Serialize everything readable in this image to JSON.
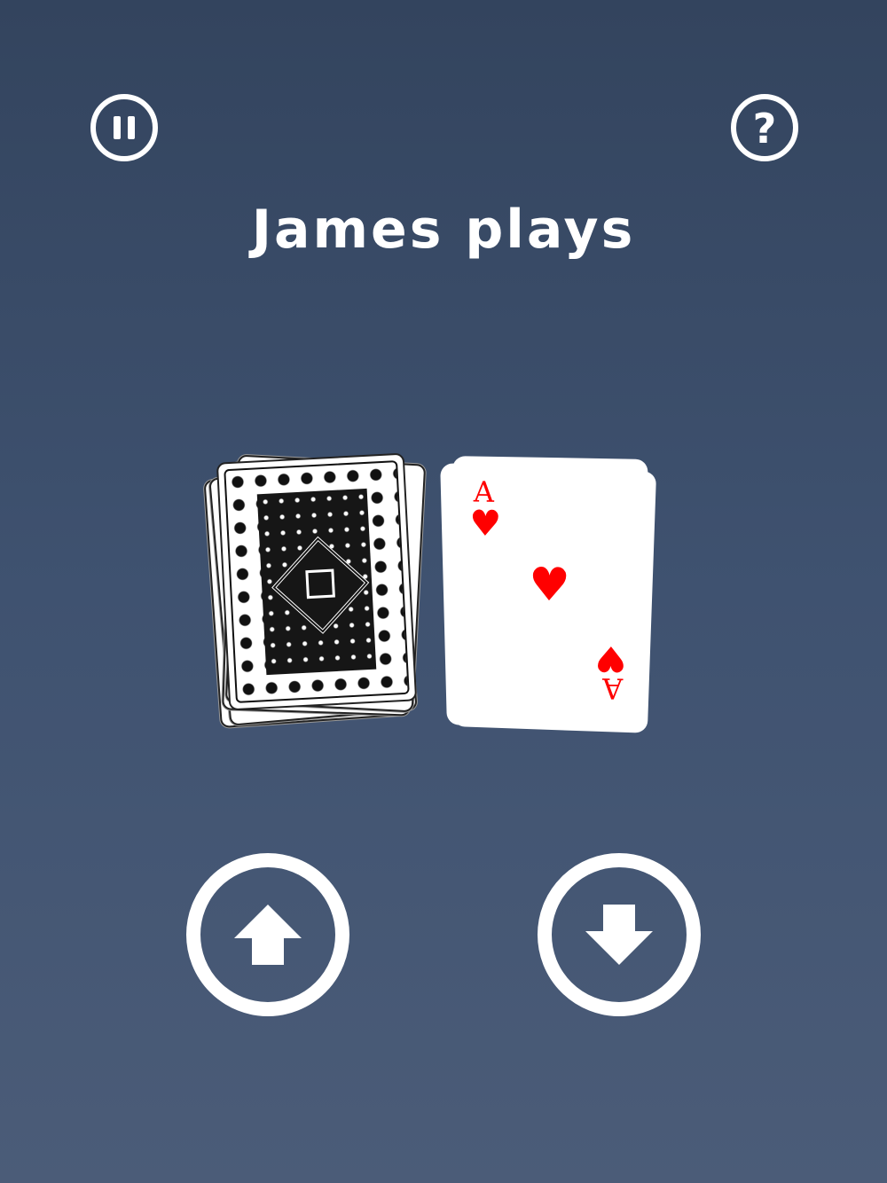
{
  "header": {
    "title": "James plays"
  },
  "controls": {
    "pause_icon": "pause-icon",
    "help_icon": "question-mark-icon",
    "help_glyph": "?",
    "higher_icon": "arrow-up-icon",
    "lower_icon": "arrow-down-icon"
  },
  "table": {
    "deck": {
      "icon": "card-back-pattern"
    },
    "current_card": {
      "rank": "A",
      "suit": "♥",
      "suit_name": "hearts",
      "color": "#ff0000"
    }
  },
  "colors": {
    "background_top": "#33445e",
    "background_bottom": "#4b5c78",
    "foreground": "#ffffff",
    "card_red": "#ff0000"
  }
}
